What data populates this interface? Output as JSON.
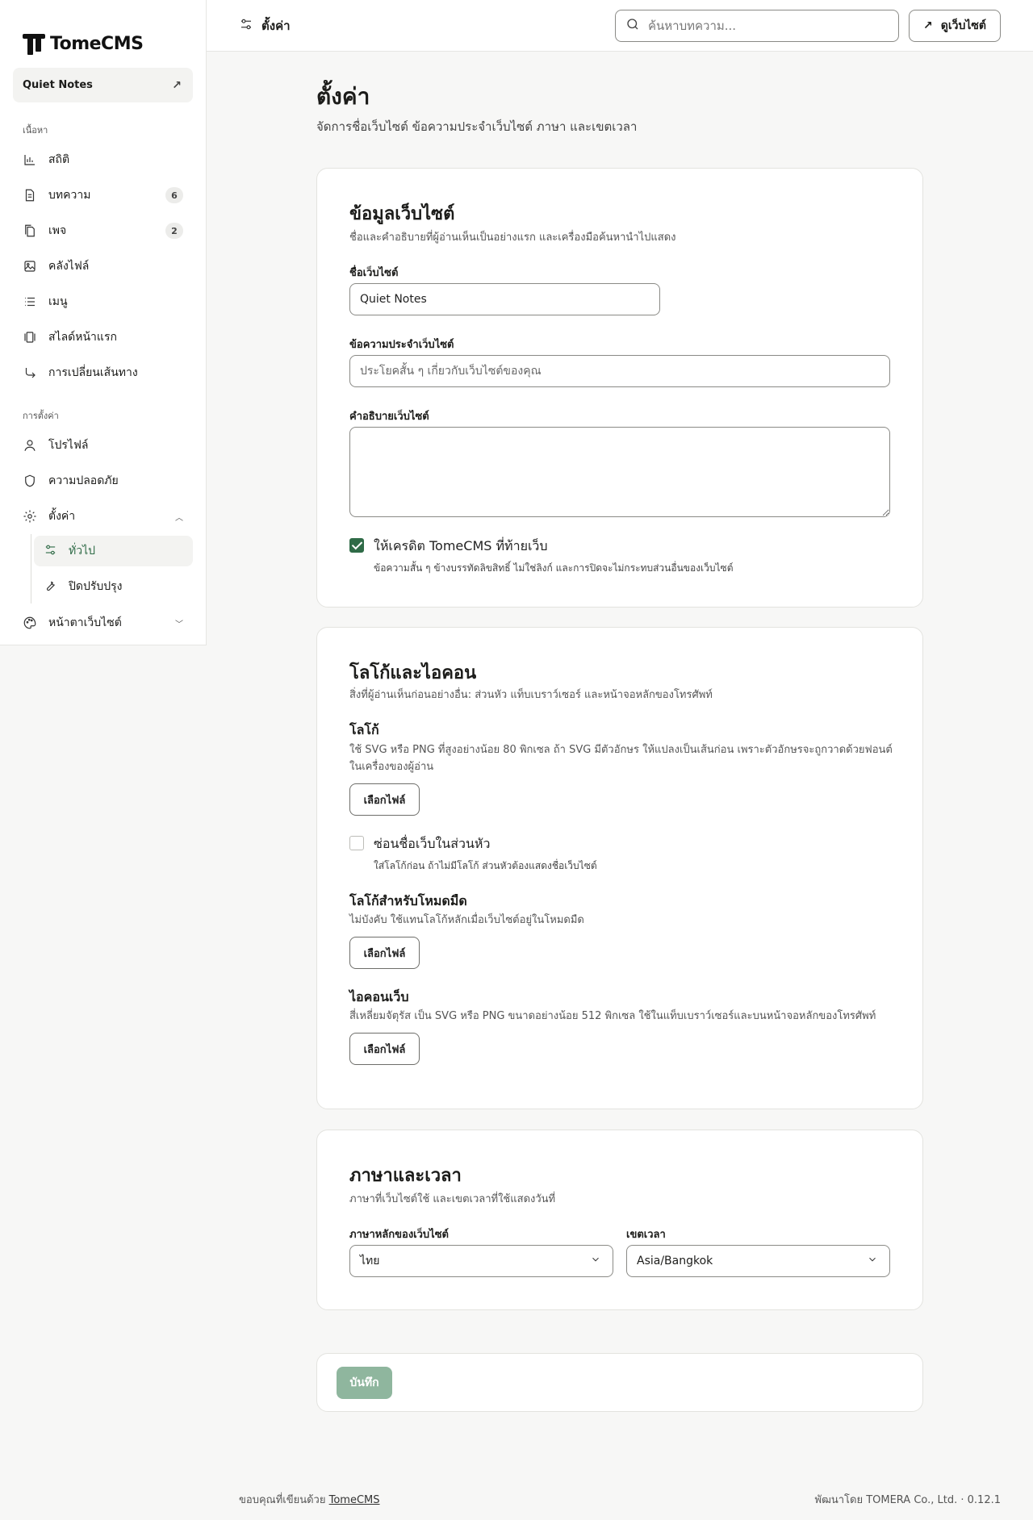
{
  "brand": {
    "name": "TomeCMS"
  },
  "site_switcher": {
    "name": "Quiet Notes"
  },
  "sidebar": {
    "content_section": "เนื้อหา",
    "content_items": [
      {
        "label": "สถิติ",
        "icon": "bar-chart-icon"
      },
      {
        "label": "บทความ",
        "icon": "document-icon",
        "badge": "6"
      },
      {
        "label": "เพจ",
        "icon": "pages-icon",
        "badge": "2"
      },
      {
        "label": "คลังไฟล์",
        "icon": "image-icon"
      },
      {
        "label": "เมนู",
        "icon": "list-icon"
      },
      {
        "label": "สไลด์หน้าแรก",
        "icon": "slides-icon"
      },
      {
        "label": "การเปลี่ยนเส้นทาง",
        "icon": "redirect-icon"
      }
    ],
    "settings_section": "การตั้งค่า",
    "settings_items": [
      {
        "label": "โปรไฟล์",
        "icon": "user-icon"
      },
      {
        "label": "ความปลอดภัย",
        "icon": "shield-icon"
      },
      {
        "label": "ตั้งค่า",
        "icon": "gear-icon"
      }
    ],
    "settings_sub": [
      {
        "label": "ทั่วไป",
        "icon": "sliders-icon",
        "active": true
      },
      {
        "label": "ปิดปรับปรุง",
        "icon": "wrench-icon"
      }
    ],
    "appearance": {
      "label": "หน้าตาเว็บไซต์",
      "icon": "palette-icon"
    }
  },
  "topbar": {
    "title": "ตั้งค่า",
    "search_placeholder": "ค้นหาบทความ...",
    "view_site": "ดูเว็บไซต์"
  },
  "page": {
    "title": "ตั้งค่า",
    "subtitle": "จัดการชื่อเว็บไซต์ ข้อความประจำเว็บไซต์ ภาษา และเขตเวลา"
  },
  "site_info": {
    "title": "ข้อมูลเว็บไซต์",
    "subtitle": "ชื่อและคำอธิบายที่ผู้อ่านเห็นเป็นอย่างแรก และเครื่องมือค้นหานำไปแสดง",
    "name_label": "ชื่อเว็บไซต์",
    "name_value": "Quiet Notes",
    "tagline_label": "ข้อความประจำเว็บไซต์",
    "tagline_placeholder": "ประโยคสั้น ๆ เกี่ยวกับเว็บไซต์ของคุณ",
    "description_label": "คำอธิบายเว็บไซต์",
    "description_value": "",
    "credit_label": "ให้เครดิต TomeCMS ที่ท้ายเว็บ",
    "credit_hint": "ข้อความสั้น ๆ ข้างบรรทัดลิขสิทธิ์ ไม่ใช่ลิงก์ และการปิดจะไม่กระทบส่วนอื่นของเว็บไซต์",
    "credit_checked": true
  },
  "logo": {
    "title": "โลโก้และไอคอน",
    "subtitle": "สิ่งที่ผู้อ่านเห็นก่อนอย่างอื่น: ส่วนหัว แท็บเบราว์เซอร์ และหน้าจอหลักของโทรศัพท์",
    "logo_title": "โลโก้",
    "logo_desc": "ใช้ SVG หรือ PNG ที่สูงอย่างน้อย 80 พิกเซล ถ้า SVG มีตัวอักษร ให้แปลงเป็นเส้นก่อน เพราะตัวอักษรจะถูกวาดด้วยฟอนต์ในเครื่องของผู้อ่าน",
    "choose_file": "เลือกไฟล์",
    "hide_name_label": "ซ่อนชื่อเว็บในส่วนหัว",
    "hide_name_hint": "ใส่โลโก้ก่อน ถ้าไม่มีโลโก้ ส่วนหัวต้องแสดงชื่อเว็บไซต์",
    "hide_name_checked": false,
    "dark_title": "โลโก้สำหรับโหมดมืด",
    "dark_desc": "ไม่บังคับ ใช้แทนโลโก้หลักเมื่อเว็บไซต์อยู่ในโหมดมืด",
    "icon_title": "ไอคอนเว็บ",
    "icon_desc": "สี่เหลี่ยมจัตุรัส เป็น SVG หรือ PNG ขนาดอย่างน้อย 512 พิกเซล ใช้ในแท็บเบราว์เซอร์และบนหน้าจอหลักของโทรศัพท์"
  },
  "lang_time": {
    "title": "ภาษาและเวลา",
    "subtitle": "ภาษาที่เว็บไซต์ใช้ และเขตเวลาที่ใช้แสดงวันที่",
    "language_label": "ภาษาหลักของเว็บไซต์",
    "language_value": "ไทย",
    "timezone_label": "เขตเวลา",
    "timezone_value": "Asia/Bangkok"
  },
  "actions": {
    "save": "บันทึก"
  },
  "footer": {
    "left_text": "ขอบคุณที่เขียนด้วย",
    "left_link": "TomeCMS",
    "right_text": "พัฒนาโดย TOMERA Co., Ltd. · 0.12.1"
  },
  "colors": {
    "accent": "#2f6b47",
    "save_disabled": "#8fb69e"
  }
}
